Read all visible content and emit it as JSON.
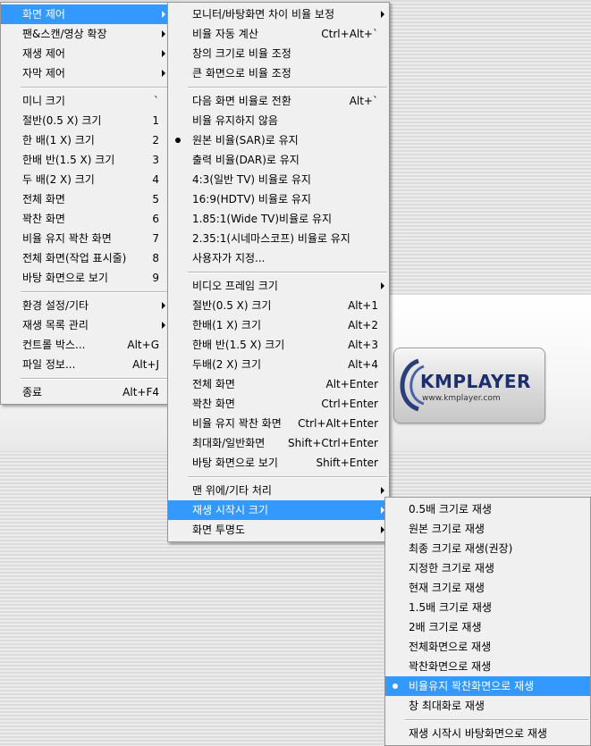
{
  "logo": {
    "brand": "KMPLAYER",
    "url": "www.kmplayer.com"
  },
  "menu1": [
    {
      "type": "item",
      "label": "화면 제어",
      "arrow": true,
      "highlight": true
    },
    {
      "type": "item",
      "label": "팬&스캔/영상 확장",
      "arrow": true
    },
    {
      "type": "item",
      "label": "재생 제어",
      "arrow": true
    },
    {
      "type": "item",
      "label": "자막 제어",
      "arrow": true
    },
    {
      "type": "sep"
    },
    {
      "type": "item",
      "label": "미니 크기",
      "shortcut": "`"
    },
    {
      "type": "item",
      "label": "절반(0.5 X) 크기",
      "shortcut": "1"
    },
    {
      "type": "item",
      "label": "한 배(1 X) 크기",
      "shortcut": "2"
    },
    {
      "type": "item",
      "label": "한배 반(1.5 X) 크기",
      "shortcut": "3"
    },
    {
      "type": "item",
      "label": "두 배(2 X) 크기",
      "shortcut": "4"
    },
    {
      "type": "item",
      "label": "전체 화면",
      "shortcut": "5"
    },
    {
      "type": "item",
      "label": "꽉찬 화면",
      "shortcut": "6"
    },
    {
      "type": "item",
      "label": "비율 유지 꽉찬 화면",
      "shortcut": "7"
    },
    {
      "type": "item",
      "label": "전체 화면(작업 표시줄)",
      "shortcut": "8"
    },
    {
      "type": "item",
      "label": "바탕 화면으로 보기",
      "shortcut": "9"
    },
    {
      "type": "sep"
    },
    {
      "type": "item",
      "label": "환경 설정/기타",
      "arrow": true
    },
    {
      "type": "item",
      "label": "재생 목록 관리",
      "arrow": true
    },
    {
      "type": "item",
      "label": "컨트롤 박스...",
      "shortcut": "Alt+G"
    },
    {
      "type": "item",
      "label": "파일 정보...",
      "shortcut": "Alt+J"
    },
    {
      "type": "sep"
    },
    {
      "type": "item",
      "label": "종료",
      "shortcut": "Alt+F4"
    }
  ],
  "menu2": [
    {
      "type": "item",
      "label": "모니터/바탕화면 차이 비율 보정",
      "arrow": true
    },
    {
      "type": "item",
      "label": "비율 자동 계산",
      "shortcut": "Ctrl+Alt+`"
    },
    {
      "type": "item",
      "label": "창의 크기로 비율 조정"
    },
    {
      "type": "item",
      "label": "큰 화면으로 비율 조정"
    },
    {
      "type": "sep"
    },
    {
      "type": "item",
      "label": "다음 화면 비율로 전환",
      "shortcut": "Alt+`"
    },
    {
      "type": "item",
      "label": "비율 유지하지 않음"
    },
    {
      "type": "item",
      "label": "원본 비율(SAR)로 유지",
      "checked": true
    },
    {
      "type": "item",
      "label": "출력 비율(DAR)로 유지"
    },
    {
      "type": "item",
      "label": "4:3(일반 TV) 비율로 유지"
    },
    {
      "type": "item",
      "label": "16:9(HDTV) 비율로 유지"
    },
    {
      "type": "item",
      "label": "1.85:1(Wide TV)비율로 유지"
    },
    {
      "type": "item",
      "label": "2.35:1(시네마스코프) 비율로 유지"
    },
    {
      "type": "item",
      "label": "사용자가 지정..."
    },
    {
      "type": "sep"
    },
    {
      "type": "item",
      "label": "비디오 프레임 크기",
      "arrow": true
    },
    {
      "type": "item",
      "label": "절반(0.5 X) 크기",
      "shortcut": "Alt+1"
    },
    {
      "type": "item",
      "label": "한배(1 X) 크기",
      "shortcut": "Alt+2"
    },
    {
      "type": "item",
      "label": "한배 반(1.5 X) 크기",
      "shortcut": "Alt+3"
    },
    {
      "type": "item",
      "label": "두배(2 X) 크기",
      "shortcut": "Alt+4"
    },
    {
      "type": "item",
      "label": "전체 화면",
      "shortcut": "Alt+Enter"
    },
    {
      "type": "item",
      "label": "꽉찬 화면",
      "shortcut": "Ctrl+Enter"
    },
    {
      "type": "item",
      "label": "비율 유지 꽉찬 화면",
      "shortcut": "Ctrl+Alt+Enter"
    },
    {
      "type": "item",
      "label": "최대화/일반화면",
      "shortcut": "Shift+Ctrl+Enter"
    },
    {
      "type": "item",
      "label": "바탕 화면으로 보기",
      "shortcut": "Shift+Enter"
    },
    {
      "type": "sep"
    },
    {
      "type": "item",
      "label": "맨 위에/기타 처리",
      "arrow": true
    },
    {
      "type": "item",
      "label": "재생 시작시 크기",
      "arrow": true,
      "highlight": true
    },
    {
      "type": "item",
      "label": "화면 투명도",
      "arrow": true
    }
  ],
  "menu3": [
    {
      "type": "item",
      "label": "0.5배 크기로 재생"
    },
    {
      "type": "item",
      "label": "원본 크기로 재생"
    },
    {
      "type": "item",
      "label": "최종 크기로 재생(권장)"
    },
    {
      "type": "item",
      "label": "지정한 크기로 재생"
    },
    {
      "type": "item",
      "label": "현재 크기로 재생"
    },
    {
      "type": "item",
      "label": "1.5배 크기로 재생"
    },
    {
      "type": "item",
      "label": "2배 크기로 재생"
    },
    {
      "type": "item",
      "label": "전체화면으로 재생"
    },
    {
      "type": "item",
      "label": "꽉찬화면으로 재생"
    },
    {
      "type": "item",
      "label": "비율유지 꽉찬화면으로 재생",
      "checked": true,
      "highlight": true
    },
    {
      "type": "item",
      "label": "창 최대화로 재생"
    },
    {
      "type": "sep"
    },
    {
      "type": "item",
      "label": "재생 시작시 바탕화면으로 재생"
    }
  ]
}
